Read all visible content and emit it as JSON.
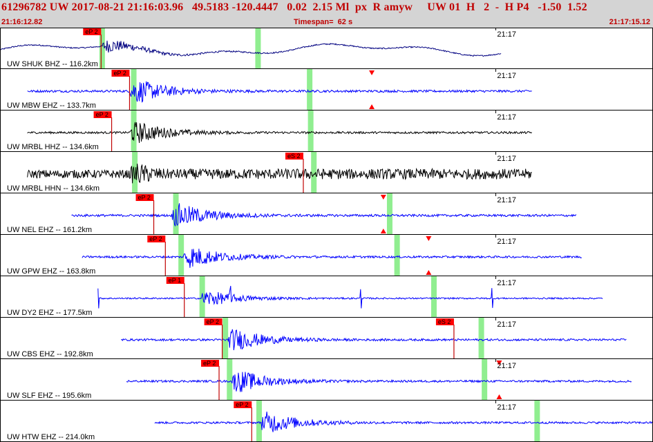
{
  "header": {
    "title": "61296782 UW 2017-08-21 21:16:03.96   49.5183 -120.4447   0.02  2.15 Ml  px  R amyw     UW 01  H   2  -  H P4   -1.50  1.52",
    "start_time": "21:16:12.82",
    "timespan_label": "Timespan=  62 s",
    "end_time": "21:17:15.12"
  },
  "colors": {
    "header_bg": "#d4d4d4",
    "header_text": "#c00000",
    "blue_trace": "#0000ff",
    "black_trace": "#000000",
    "navy_trace": "#000080",
    "pick_box": "#ff0000",
    "pick_line": "#c00000",
    "marker": "#ff0000",
    "window_band": "#90ee90"
  },
  "chart_data": {
    "type": "line",
    "x_unit": "s",
    "xlim": [
      0,
      62
    ],
    "minute_label": "21:17",
    "minute_tick_x": 47.2,
    "traces": [
      {
        "label": "UW SHUK BHZ -- 116.2km",
        "color": "#000080",
        "start": 0,
        "end": 47.6,
        "onset": 9.6,
        "amp": 0.55,
        "style": "low",
        "picks": [
          {
            "label": "eP 2",
            "x": 9.6
          }
        ],
        "windows": [
          9.7,
          24.5
        ],
        "triangles": []
      },
      {
        "label": "UW MBW EHZ -- 133.7km",
        "color": "#0000ff",
        "start": 2.6,
        "end": 50.5,
        "onset": 12.3,
        "amp": 0.6,
        "style": "hf",
        "picks": [
          {
            "label": "eP 2",
            "x": 12.3
          }
        ],
        "windows": [
          12.7,
          29.4
        ],
        "triangles": [
          {
            "x": 35.3,
            "pos": "top"
          },
          {
            "x": 35.3,
            "pos": "bottom"
          }
        ]
      },
      {
        "label": "UW MRBL HHZ -- 134.6km",
        "color": "#000000",
        "start": 2.6,
        "end": 50.5,
        "onset": 12.3,
        "amp": 0.55,
        "style": "hf",
        "picks": [
          {
            "label": "eP 2",
            "x": 10.6
          }
        ],
        "windows": [
          12.7,
          29.5
        ],
        "triangles": []
      },
      {
        "label": "UW MRBL HHN -- 134.6km",
        "color": "#000000",
        "start": 2.6,
        "end": 50.5,
        "onset": 12.3,
        "amp": 0.55,
        "style": "strong",
        "picks": [
          {
            "label": "eS 2",
            "x": 28.8
          }
        ],
        "windows": [
          12.8,
          29.8
        ],
        "triangles": []
      },
      {
        "label": "UW NEL EHZ -- 161.2km",
        "color": "#0000ff",
        "start": 6.8,
        "end": 54.7,
        "onset": 16.3,
        "amp": 0.6,
        "style": "hf",
        "picks": [
          {
            "label": "eP 2",
            "x": 14.6
          }
        ],
        "windows": [
          16.7,
          37.0
        ],
        "triangles": [
          {
            "x": 36.4,
            "pos": "top"
          },
          {
            "x": 36.4,
            "pos": "bottom"
          }
        ]
      },
      {
        "label": "UW GPW EHZ -- 163.8km",
        "color": "#0000ff",
        "start": 7.8,
        "end": 55.3,
        "onset": 17.4,
        "amp": 0.55,
        "style": "hf",
        "picks": [
          {
            "label": "eP 2",
            "x": 15.7
          }
        ],
        "windows": [
          17.2,
          37.7
        ],
        "triangles": [
          {
            "x": 40.7,
            "pos": "top"
          },
          {
            "x": 40.7,
            "pos": "bottom"
          }
        ]
      },
      {
        "label": "UW DY2 EHZ -- 177.5km",
        "color": "#0000ff",
        "start": 9.3,
        "end": 57.2,
        "onset": 19.0,
        "amp": 0.4,
        "style": "spiky",
        "picks": [
          {
            "label": "eP 1",
            "x": 17.5
          }
        ],
        "windows": [
          19.2,
          41.2
        ],
        "triangles": []
      },
      {
        "label": "UW CBS EHZ -- 192.8km",
        "color": "#0000ff",
        "start": 11.5,
        "end": 59.5,
        "onset": 21.6,
        "amp": 0.55,
        "style": "hf",
        "picks": [
          {
            "label": "eP 2",
            "x": 21.1
          },
          {
            "label": "eS 2",
            "x": 43.1
          }
        ],
        "windows": [
          21.4,
          45.7
        ],
        "triangles": []
      },
      {
        "label": "UW SLF EHZ -- 195.6km",
        "color": "#0000ff",
        "start": 12.0,
        "end": 60.0,
        "onset": 22.0,
        "amp": 0.55,
        "style": "hf",
        "picks": [
          {
            "label": "eP 2",
            "x": 20.8
          }
        ],
        "windows": [
          21.8,
          46.0
        ],
        "triangles": [
          {
            "x": 47.4,
            "pos": "top"
          },
          {
            "x": 47.4,
            "pos": "bottom"
          }
        ]
      },
      {
        "label": "UW HTW EHZ -- 214.0km",
        "color": "#0000ff",
        "start": 14.7,
        "end": 62,
        "onset": 24.7,
        "amp": 0.55,
        "style": "hf",
        "picks": [
          {
            "label": "eP 2",
            "x": 23.9
          }
        ],
        "windows": [
          24.6,
          51.0
        ],
        "triangles": []
      }
    ]
  }
}
